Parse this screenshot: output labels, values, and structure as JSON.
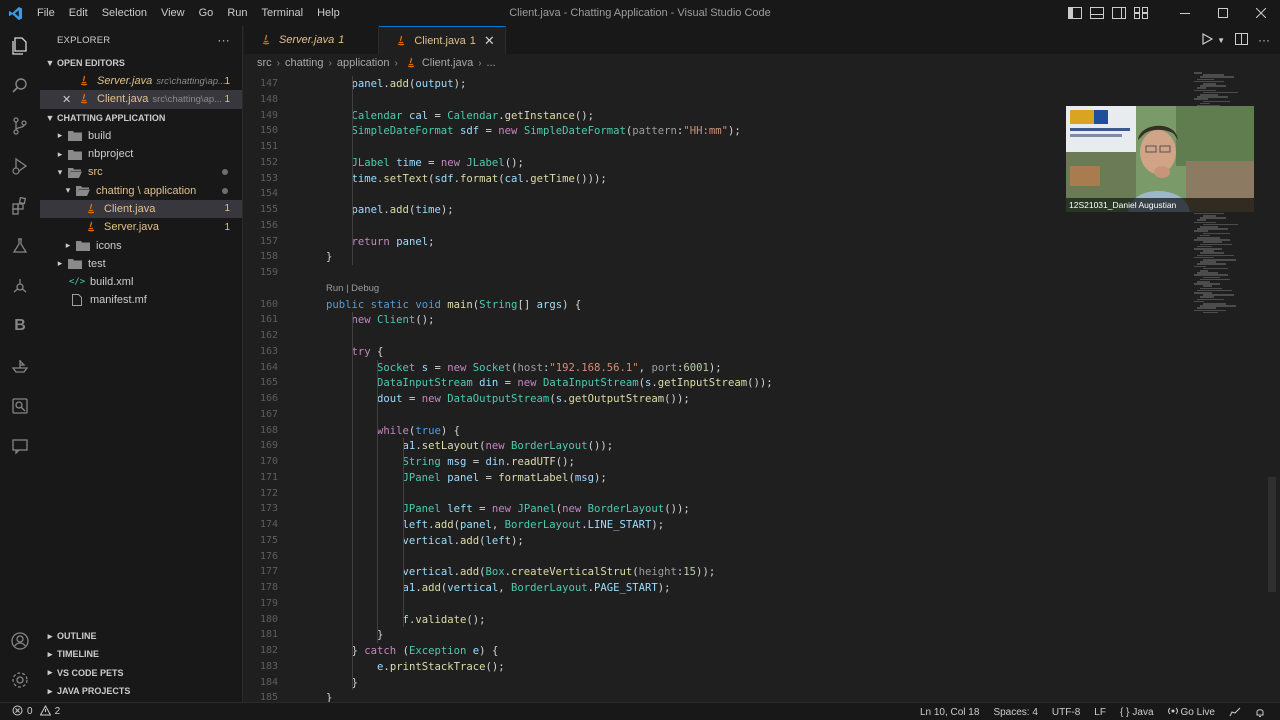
{
  "window": {
    "title": "Client.java - Chatting Application - Visual Studio Code",
    "menu": [
      "File",
      "Edit",
      "Selection",
      "View",
      "Go",
      "Run",
      "Terminal",
      "Help"
    ]
  },
  "sidebar": {
    "title": "EXPLORER",
    "more": "···",
    "open_editors": {
      "label": "OPEN EDITORS",
      "items": [
        {
          "name": "Server.java",
          "path": "src\\chatting\\ap...",
          "badge": "1"
        },
        {
          "name": "Client.java",
          "path": "src\\chatting\\ap...",
          "badge": "1"
        }
      ]
    },
    "project": {
      "label": "CHATTING APPLICATION",
      "tree": [
        {
          "name": "build"
        },
        {
          "name": "nbproject"
        },
        {
          "name": "src"
        },
        {
          "name": "chatting \\ application"
        },
        {
          "name": "Client.java",
          "badge": "1"
        },
        {
          "name": "Server.java",
          "badge": "1"
        },
        {
          "name": "icons"
        },
        {
          "name": "test"
        },
        {
          "name": "build.xml"
        },
        {
          "name": "manifest.mf"
        }
      ]
    },
    "bottom_sections": [
      "OUTLINE",
      "TIMELINE",
      "VS CODE PETS",
      "JAVA PROJECTS"
    ]
  },
  "tabs": [
    {
      "name": "Server.java",
      "badge": "1"
    },
    {
      "name": "Client.java",
      "badge": "1",
      "close": "✕"
    }
  ],
  "breadcrumb": [
    "src",
    "chatting",
    "application",
    "Client.java",
    "..."
  ],
  "editor": {
    "codelens": "Run | Debug",
    "lines": [
      {
        "n": "147",
        "text": "    panel.add(output);"
      },
      {
        "n": "148",
        "text": ""
      },
      {
        "n": "149",
        "text": "    Calendar cal = Calendar.getInstance();"
      },
      {
        "n": "150",
        "text": "    SimpleDateFormat sdf = new SimpleDateFormat(pattern:\"HH:mm\");"
      },
      {
        "n": "151",
        "text": ""
      },
      {
        "n": "152",
        "text": "    JLabel time = new JLabel();"
      },
      {
        "n": "153",
        "text": "    time.setText(sdf.format(cal.getTime()));"
      },
      {
        "n": "154",
        "text": ""
      },
      {
        "n": "155",
        "text": "    panel.add(time);"
      },
      {
        "n": "156",
        "text": ""
      },
      {
        "n": "157",
        "text": "    return panel;"
      },
      {
        "n": "158",
        "text": "}"
      },
      {
        "n": "159",
        "text": ""
      },
      {
        "n": "160",
        "text": "public static void main(String[] args) {"
      },
      {
        "n": "161",
        "text": "    new Client();"
      },
      {
        "n": "162",
        "text": ""
      },
      {
        "n": "163",
        "text": "    try {"
      },
      {
        "n": "164",
        "text": "        Socket s = new Socket(host:\"192.168.56.1\", port:6001);"
      },
      {
        "n": "165",
        "text": "        DataInputStream din = new DataInputStream(s.getInputStream());"
      },
      {
        "n": "166",
        "text": "        dout = new DataOutputStream(s.getOutputStream());"
      },
      {
        "n": "167",
        "text": ""
      },
      {
        "n": "168",
        "text": "        while(true) {"
      },
      {
        "n": "169",
        "text": "            a1.setLayout(new BorderLayout());"
      },
      {
        "n": "170",
        "text": "            String msg = din.readUTF();"
      },
      {
        "n": "171",
        "text": "            JPanel panel = formatLabel(msg);"
      },
      {
        "n": "172",
        "text": ""
      },
      {
        "n": "173",
        "text": "            JPanel left = new JPanel(new BorderLayout());"
      },
      {
        "n": "174",
        "text": "            left.add(panel, BorderLayout.LINE_START);"
      },
      {
        "n": "175",
        "text": "            vertical.add(left);"
      },
      {
        "n": "176",
        "text": ""
      },
      {
        "n": "177",
        "text": "            vertical.add(Box.createVerticalStrut(height:15));"
      },
      {
        "n": "178",
        "text": "            a1.add(vertical, BorderLayout.PAGE_START);"
      },
      {
        "n": "179",
        "text": ""
      },
      {
        "n": "180",
        "text": "            f.validate();"
      },
      {
        "n": "181",
        "text": "        }"
      },
      {
        "n": "182",
        "text": "    } catch (Exception e) {"
      },
      {
        "n": "183",
        "text": "        e.printStackTrace();"
      },
      {
        "n": "184",
        "text": "    }"
      },
      {
        "n": "185",
        "text": "}"
      }
    ]
  },
  "webcam": {
    "name": "12S21031_Daniel Augustian"
  },
  "status": {
    "errors": "0",
    "warnings": "2",
    "position": "Ln 10, Col 18",
    "spaces": "Spaces: 4",
    "encoding": "UTF-8",
    "eol": "LF",
    "language": "Java",
    "golive": "Go Live"
  },
  "colors": {
    "accent": "#0078d4",
    "modified": "#e2c08d",
    "background": "#1f1f1f",
    "keyword": "#c586c0",
    "type": "#4ec9b0",
    "function": "#dcdcaa",
    "string": "#ce9178",
    "variable": "#9cdcfe",
    "declaration": "#569cd6",
    "number": "#b5cea8"
  }
}
